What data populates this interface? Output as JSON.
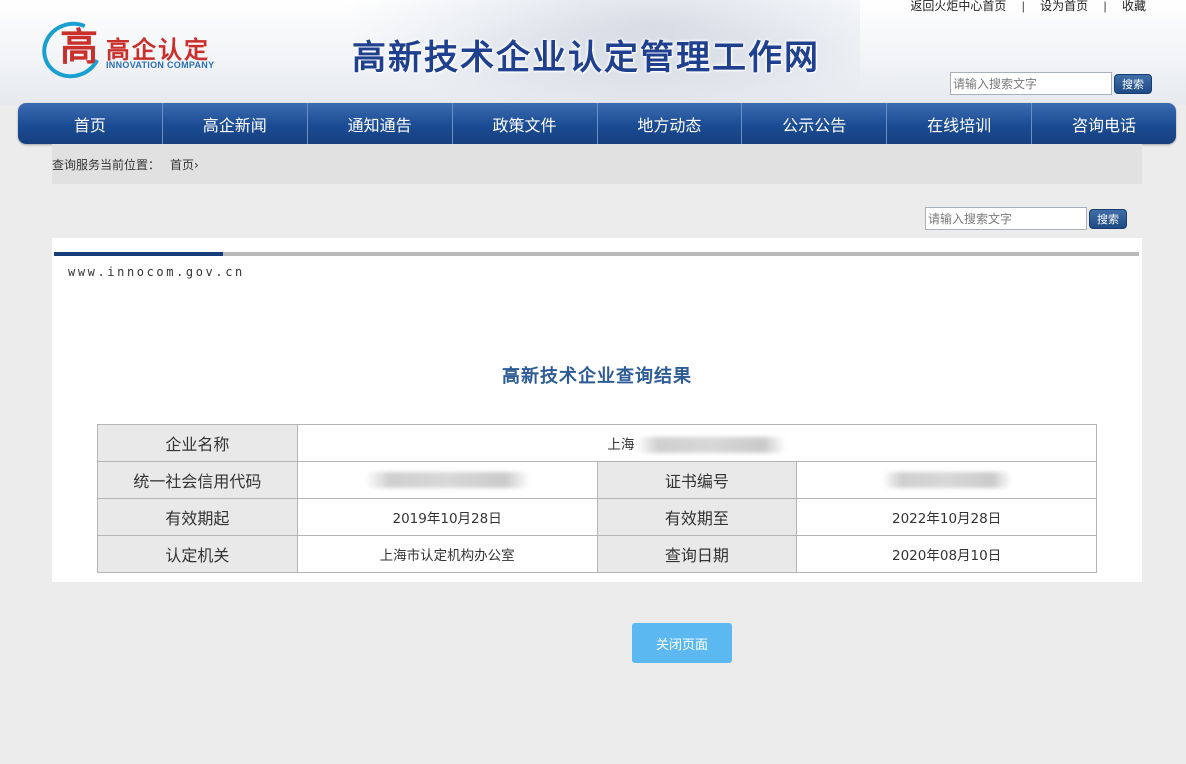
{
  "top_links": {
    "home_center": "返回火炬中心首页",
    "set_home": "设为首页",
    "favorite": "收藏"
  },
  "logo": {
    "glyph": "高",
    "cn": "高企认定",
    "en": "INNOVATION COMPANY"
  },
  "site_title": "高新技术企业认定管理工作网",
  "header_search": {
    "placeholder": "请输入搜索文字",
    "button": "搜索"
  },
  "nav": {
    "items": [
      {
        "label": "首页"
      },
      {
        "label": "高企新闻"
      },
      {
        "label": "通知通告"
      },
      {
        "label": "政策文件"
      },
      {
        "label": "地方动态"
      },
      {
        "label": "公示公告"
      },
      {
        "label": "在线培训"
      },
      {
        "label": "咨询电话"
      }
    ]
  },
  "breadcrumb": {
    "label": "查询服务当前位置：",
    "crumb": "首页",
    "separator": "›"
  },
  "page_search": {
    "placeholder": "请输入搜索文字",
    "button": "搜索"
  },
  "card": {
    "url": "www.innocom.gov.cn",
    "title": "高新技术企业查询结果"
  },
  "result": {
    "company_name_label": "企业名称",
    "company_name_value": "上海",
    "credit_code_label": "统一社会信用代码",
    "cert_no_label": "证书编号",
    "valid_from_label": "有效期起",
    "valid_from_value": "2019年10月28日",
    "valid_to_label": "有效期至",
    "valid_to_value": "2022年10月28日",
    "authority_label": "认定机关",
    "authority_value": "上海市认定机构办公室",
    "query_date_label": "查询日期",
    "query_date_value": "2020年08月10日"
  },
  "close_button": "关闭页面"
}
